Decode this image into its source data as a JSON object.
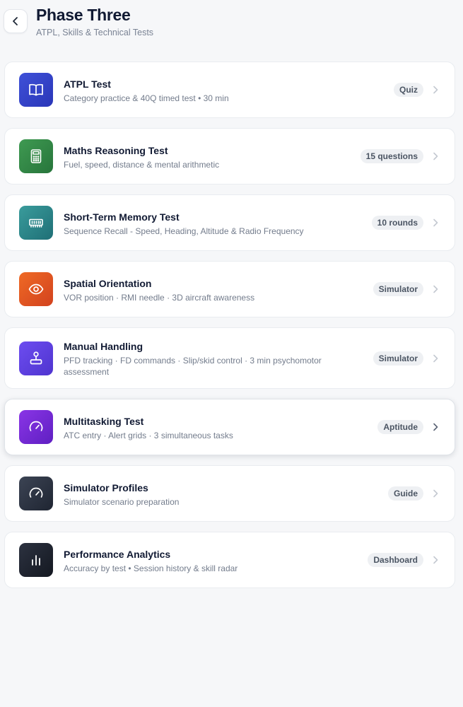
{
  "header": {
    "title": "Phase Three",
    "subtitle": "ATPL, Skills & Technical Tests",
    "back_icon": "chevron-left-icon"
  },
  "items": [
    {
      "title": "ATPL Test",
      "desc": "Category practice & 40Q timed test • 30 min",
      "badge": "Quiz",
      "icon": "book-open-icon",
      "color_from": "#3f51d8",
      "color_to": "#2a36b8"
    },
    {
      "title": "Maths Reasoning Test",
      "desc": "Fuel, speed, distance & mental arithmetic",
      "badge": "15 questions",
      "icon": "calculator-icon",
      "color_from": "#3f9a52",
      "color_to": "#27753b"
    },
    {
      "title": "Short-Term Memory Test",
      "desc": "Sequence Recall - Speed, Heading, Altitude & Radio Frequency",
      "badge": "10 rounds",
      "icon": "memory-chip-icon",
      "color_from": "#3a9c9c",
      "color_to": "#1f6f76"
    },
    {
      "title": "Spatial Orientation",
      "desc": "VOR position · RMI needle · 3D aircraft awareness",
      "badge": "Simulator",
      "icon": "eye-icon",
      "color_from": "#ef6a25",
      "color_to": "#d2421e"
    },
    {
      "title": "Manual Handling",
      "desc": "PFD tracking · FD commands · Slip/skid control · 3 min psychomotor assessment",
      "badge": "Simulator",
      "icon": "joystick-icon",
      "color_from": "#6d4df0",
      "color_to": "#4f34cf"
    },
    {
      "title": "Multitasking Test",
      "desc": "ATC entry · Alert grids · 3 simultaneous tasks",
      "badge": "Aptitude",
      "icon": "gauge-icon",
      "color_from": "#8a35e6",
      "color_to": "#5f1fc2"
    },
    {
      "title": "Simulator Profiles",
      "desc": "Simulator scenario preparation",
      "badge": "Guide",
      "icon": "gauge-icon",
      "color_from": "#3c4454",
      "color_to": "#1f2532"
    },
    {
      "title": "Performance Analytics",
      "desc": "Accuracy by test • Session history & skill radar",
      "badge": "Dashboard",
      "icon": "bar-chart-icon",
      "color_from": "#2c3240",
      "color_to": "#141821"
    }
  ]
}
